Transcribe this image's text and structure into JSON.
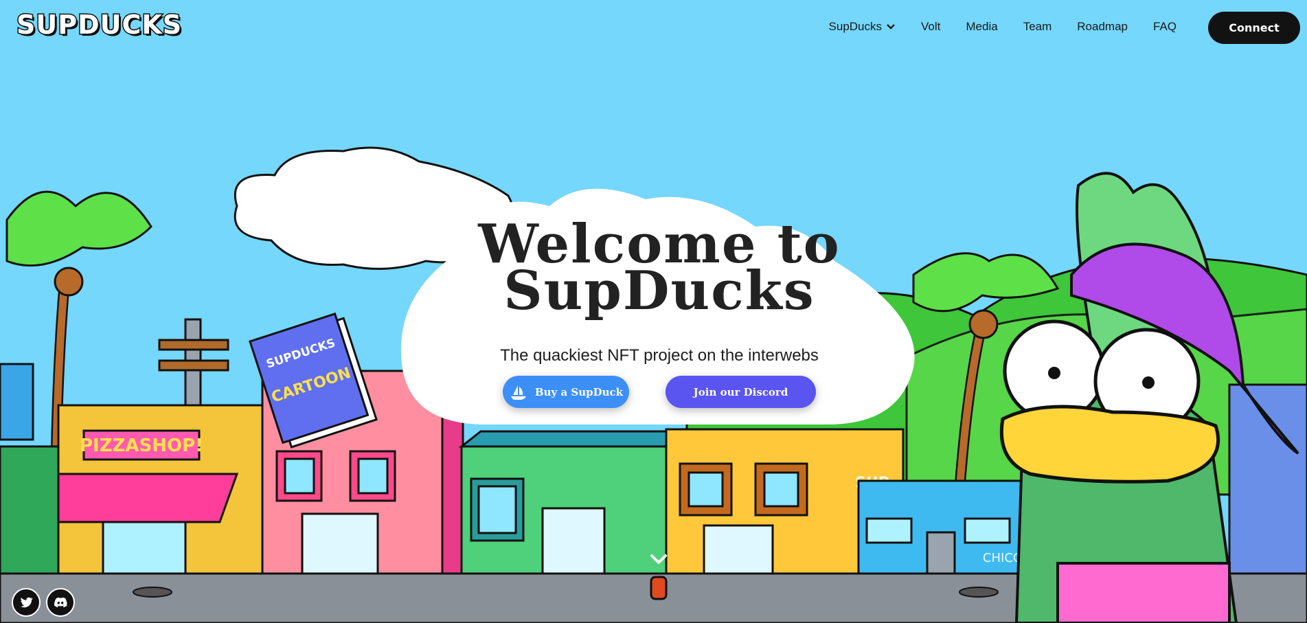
{
  "brand": {
    "logo_text": "SUPDUCKS"
  },
  "nav": {
    "items": [
      {
        "label": "SupDucks",
        "has_dropdown": true
      },
      {
        "label": "Volt"
      },
      {
        "label": "Media"
      },
      {
        "label": "Team"
      },
      {
        "label": "Roadmap"
      },
      {
        "label": "FAQ"
      }
    ],
    "connect_label": "Connect"
  },
  "hero": {
    "title_line1": "Welcome to",
    "title_line2": "SupDucks",
    "subtitle": "The quackiest NFT project on the interwebs",
    "buy_label": "Buy a SupDuck",
    "discord_label": "Join our Discord"
  },
  "scene_text": {
    "shop_sign": "PIZZASHOP!",
    "book_title_top": "SUPDUCKS",
    "book_title_bottom": "CARTOON",
    "graffiti_1": "SUP",
    "graffiti_2": "CHICO"
  },
  "social": [
    {
      "icon": "twitter-icon"
    },
    {
      "icon": "discord-icon"
    }
  ],
  "colors": {
    "sky": "#74d7fb",
    "buy_button": "#3d8ff8",
    "discord_button": "#5a54f0",
    "connect_button": "#121212"
  }
}
